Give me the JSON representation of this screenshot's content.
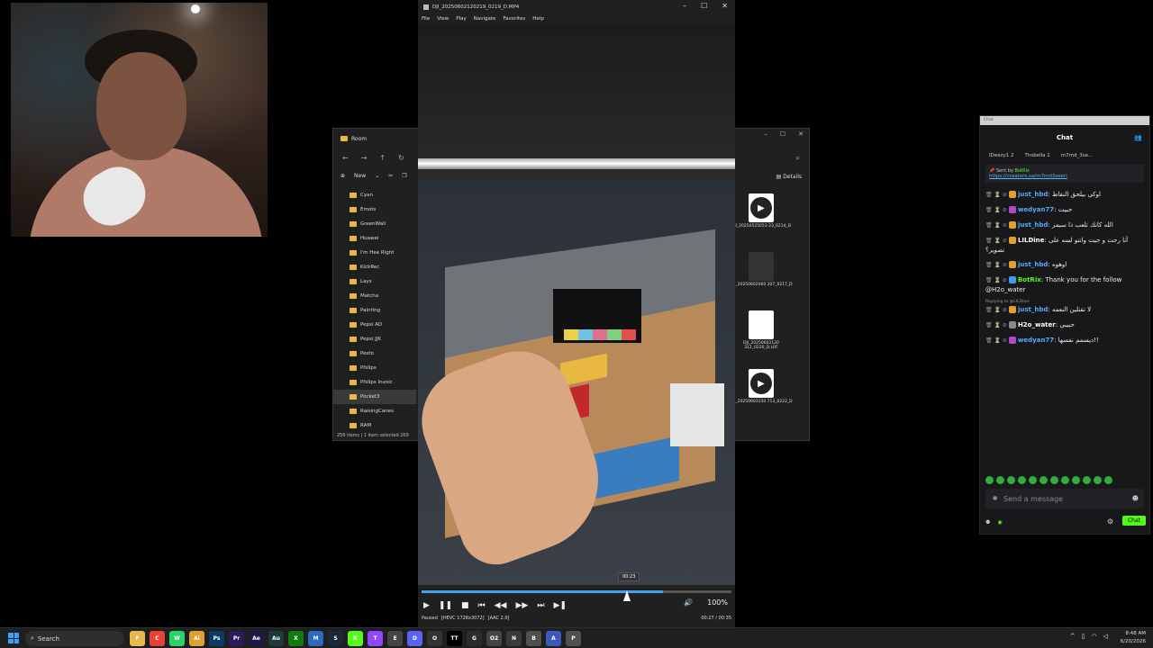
{
  "webcam": {},
  "explorer": {
    "title": "Room",
    "new_label": "New",
    "details_label": "Details",
    "folders": [
      "Cyan",
      "Emots",
      "GreenWall",
      "Huawei",
      "I'm Hee Right",
      "KickRec",
      "Lays",
      "Matcha",
      "Painting",
      "Pepsi AD",
      "Pepsi JJK",
      "Pesto",
      "Philips",
      "Philips Invoic",
      "Pocket3",
      "RaisingCanes",
      "RAM"
    ],
    "selected_folder": "Pocket3",
    "status": "256 items | 1 item selected 269",
    "files": [
      {
        "name": "DJI_20250525053 23_0214_D",
        "thumb": "play"
      },
      {
        "name": "DJI_20250602060 307_0217_D",
        "thumb": "dark"
      },
      {
        "name": "DJI_20250602120 312_0220_D.LRF",
        "thumb": "blank"
      },
      {
        "name": "DJI_20250603150 713_0222_D",
        "thumb": "play"
      }
    ]
  },
  "player": {
    "title": "DJI_20250602120219_0219_D.MP4",
    "menu": [
      "File",
      "View",
      "Play",
      "Navigate",
      "Favorites",
      "Help"
    ],
    "tooltip_time": "00:23",
    "status_state": "Paused",
    "status_codec": "[HEVC 1728x3072]",
    "status_audio": "[AAC 2.0]",
    "time": "00:27 / 00:35",
    "volume": "100%",
    "progress": 0.66,
    "progress_fill": 0.78
  },
  "chat": {
    "top_label": "Chat",
    "title": "Chat",
    "gifters": [
      "IDeezy1 2",
      "Thsbella 1",
      "m7md_3se..."
    ],
    "pinned_by": "Sent by",
    "pinned_user": "BotRix",
    "pinned_link": "https://creators.sa/m7md3seeri",
    "messages": [
      {
        "user": "just_hbd",
        "color": "#53a9ff",
        "text": "اوكي بيلحق النقاط",
        "badge": "#e0a030"
      },
      {
        "user": "wedyan77",
        "color": "#53a9ff",
        "text": "حبيت",
        "badge": "#b04ac0"
      },
      {
        "user": "just_hbd",
        "color": "#53a9ff",
        "text": "الله كانك تلعب ذا سيمز",
        "badge": "#e0a030"
      },
      {
        "user": "LILDine",
        "color": "#ffffff",
        "text": "أنا رحت و جيت وانتو لسه على تصوير؟",
        "badge": "#e0a030"
      },
      {
        "user": "just_hbd",
        "color": "#53a9ff",
        "text": "اوهوه",
        "badge": "#e0a030"
      },
      {
        "user": "BotRix",
        "color": "#53fc18",
        "text": "Thank you for the follow @H2o_water",
        "badge": "#3aa0e8"
      },
      {
        "user": "just_hbd",
        "color": "#53a9ff",
        "text": "لا تقتلين النعمه",
        "badge": "#e0a030",
        "reply": "Replying to @LILDine:"
      },
      {
        "user": "H2o_water",
        "color": "#ffffff",
        "text": "حبيبي",
        "badge": "#888888"
      },
      {
        "user": "wedyan77",
        "color": "#53a9ff",
        "text": "ديسمم نفسها!!",
        "badge": "#b04ac0"
      }
    ],
    "input_placeholder": "Send a message",
    "chat_button": "Chat",
    "accent": "#53fc18"
  },
  "taskbar": {
    "search": "Search",
    "time": "8:48 AM",
    "date": "6/20/2026",
    "apps": [
      {
        "label": "F",
        "color": "#e8b84a"
      },
      {
        "label": "C",
        "color": "#e94235"
      },
      {
        "label": "W",
        "color": "#25d366"
      },
      {
        "label": "Ai",
        "color": "#e0a030"
      },
      {
        "label": "Ps",
        "color": "#0a3a66"
      },
      {
        "label": "Pr",
        "color": "#2a1b5c"
      },
      {
        "label": "Ae",
        "color": "#1f1848"
      },
      {
        "label": "Au",
        "color": "#1b3a3a"
      },
      {
        "label": "X",
        "color": "#107c10"
      },
      {
        "label": "M",
        "color": "#2a6ac0"
      },
      {
        "label": "S",
        "color": "#1b2838"
      },
      {
        "label": "K",
        "color": "#53fc18"
      },
      {
        "label": "T",
        "color": "#9146ff"
      },
      {
        "label": "E",
        "color": "#444444"
      },
      {
        "label": "D",
        "color": "#5865f2"
      },
      {
        "label": "O",
        "color": "#333333"
      },
      {
        "label": "TT",
        "color": "#000000"
      },
      {
        "label": "G",
        "color": "#2c2c2c"
      },
      {
        "label": "O2",
        "color": "#444444"
      },
      {
        "label": "N",
        "color": "#3a3a3a"
      },
      {
        "label": "B",
        "color": "#505050"
      },
      {
        "label": "A",
        "color": "#3a5ac0"
      },
      {
        "label": "P",
        "color": "#505050"
      }
    ]
  }
}
